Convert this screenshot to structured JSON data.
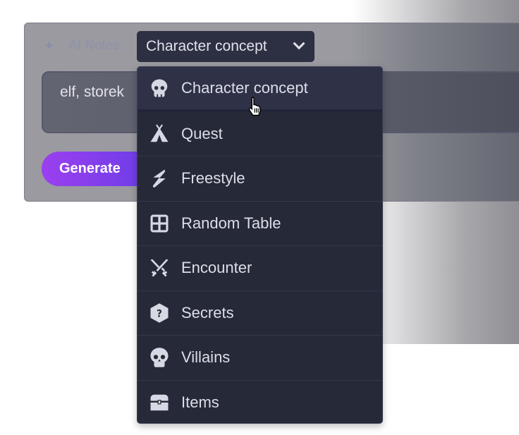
{
  "header": {
    "label": "AI Notes:",
    "icon": "sparkles-icon",
    "selected": "Character concept"
  },
  "input": {
    "value": "elf, storek"
  },
  "generate_label": "Generate",
  "dropdown": {
    "items": [
      {
        "label": "Character concept",
        "icon": "skull-icon",
        "active": true
      },
      {
        "label": "Quest",
        "icon": "tent-icon"
      },
      {
        "label": "Freestyle",
        "icon": "bolt-icon"
      },
      {
        "label": "Random Table",
        "icon": "table-icon"
      },
      {
        "label": "Encounter",
        "icon": "crossed-swords-icon"
      },
      {
        "label": "Secrets",
        "icon": "question-hexagon-icon"
      },
      {
        "label": "Villains",
        "icon": "skull-crossbones-icon"
      },
      {
        "label": "Items",
        "icon": "treasure-chest-icon"
      }
    ]
  },
  "colors": {
    "accent_start": "#9b3ff0",
    "accent_end": "#6a3ee6",
    "menu_bg": "#262938"
  }
}
